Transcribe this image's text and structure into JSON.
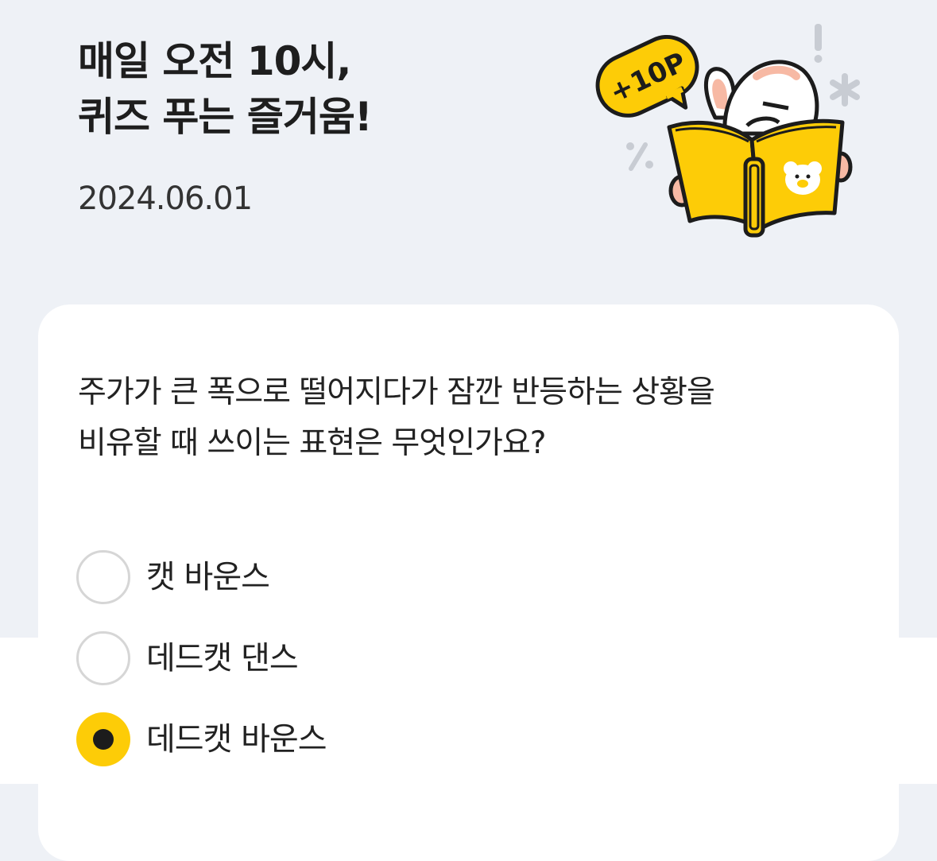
{
  "header": {
    "title_line1": "매일 오전 10시,",
    "title_line2": "퀴즈 푸는 즐거움!",
    "date": "2024.06.01"
  },
  "illustration": {
    "badge_text": "+10P",
    "icon": "rabbit-reading-book-illustration"
  },
  "quiz": {
    "question_line1": "주가가 큰 폭으로 떨어지다가 잠깐 반등하는 상황을",
    "question_line2": "비유할 때 쓰이는 표현은 무엇인가요?",
    "options": [
      {
        "label": "캣 바운스",
        "selected": false
      },
      {
        "label": "데드캣 댄스",
        "selected": false
      },
      {
        "label": "데드캣 바운스",
        "selected": true
      }
    ]
  },
  "colors": {
    "background": "#eef1f6",
    "accent_yellow": "#fdcc07",
    "card": "#ffffff"
  }
}
